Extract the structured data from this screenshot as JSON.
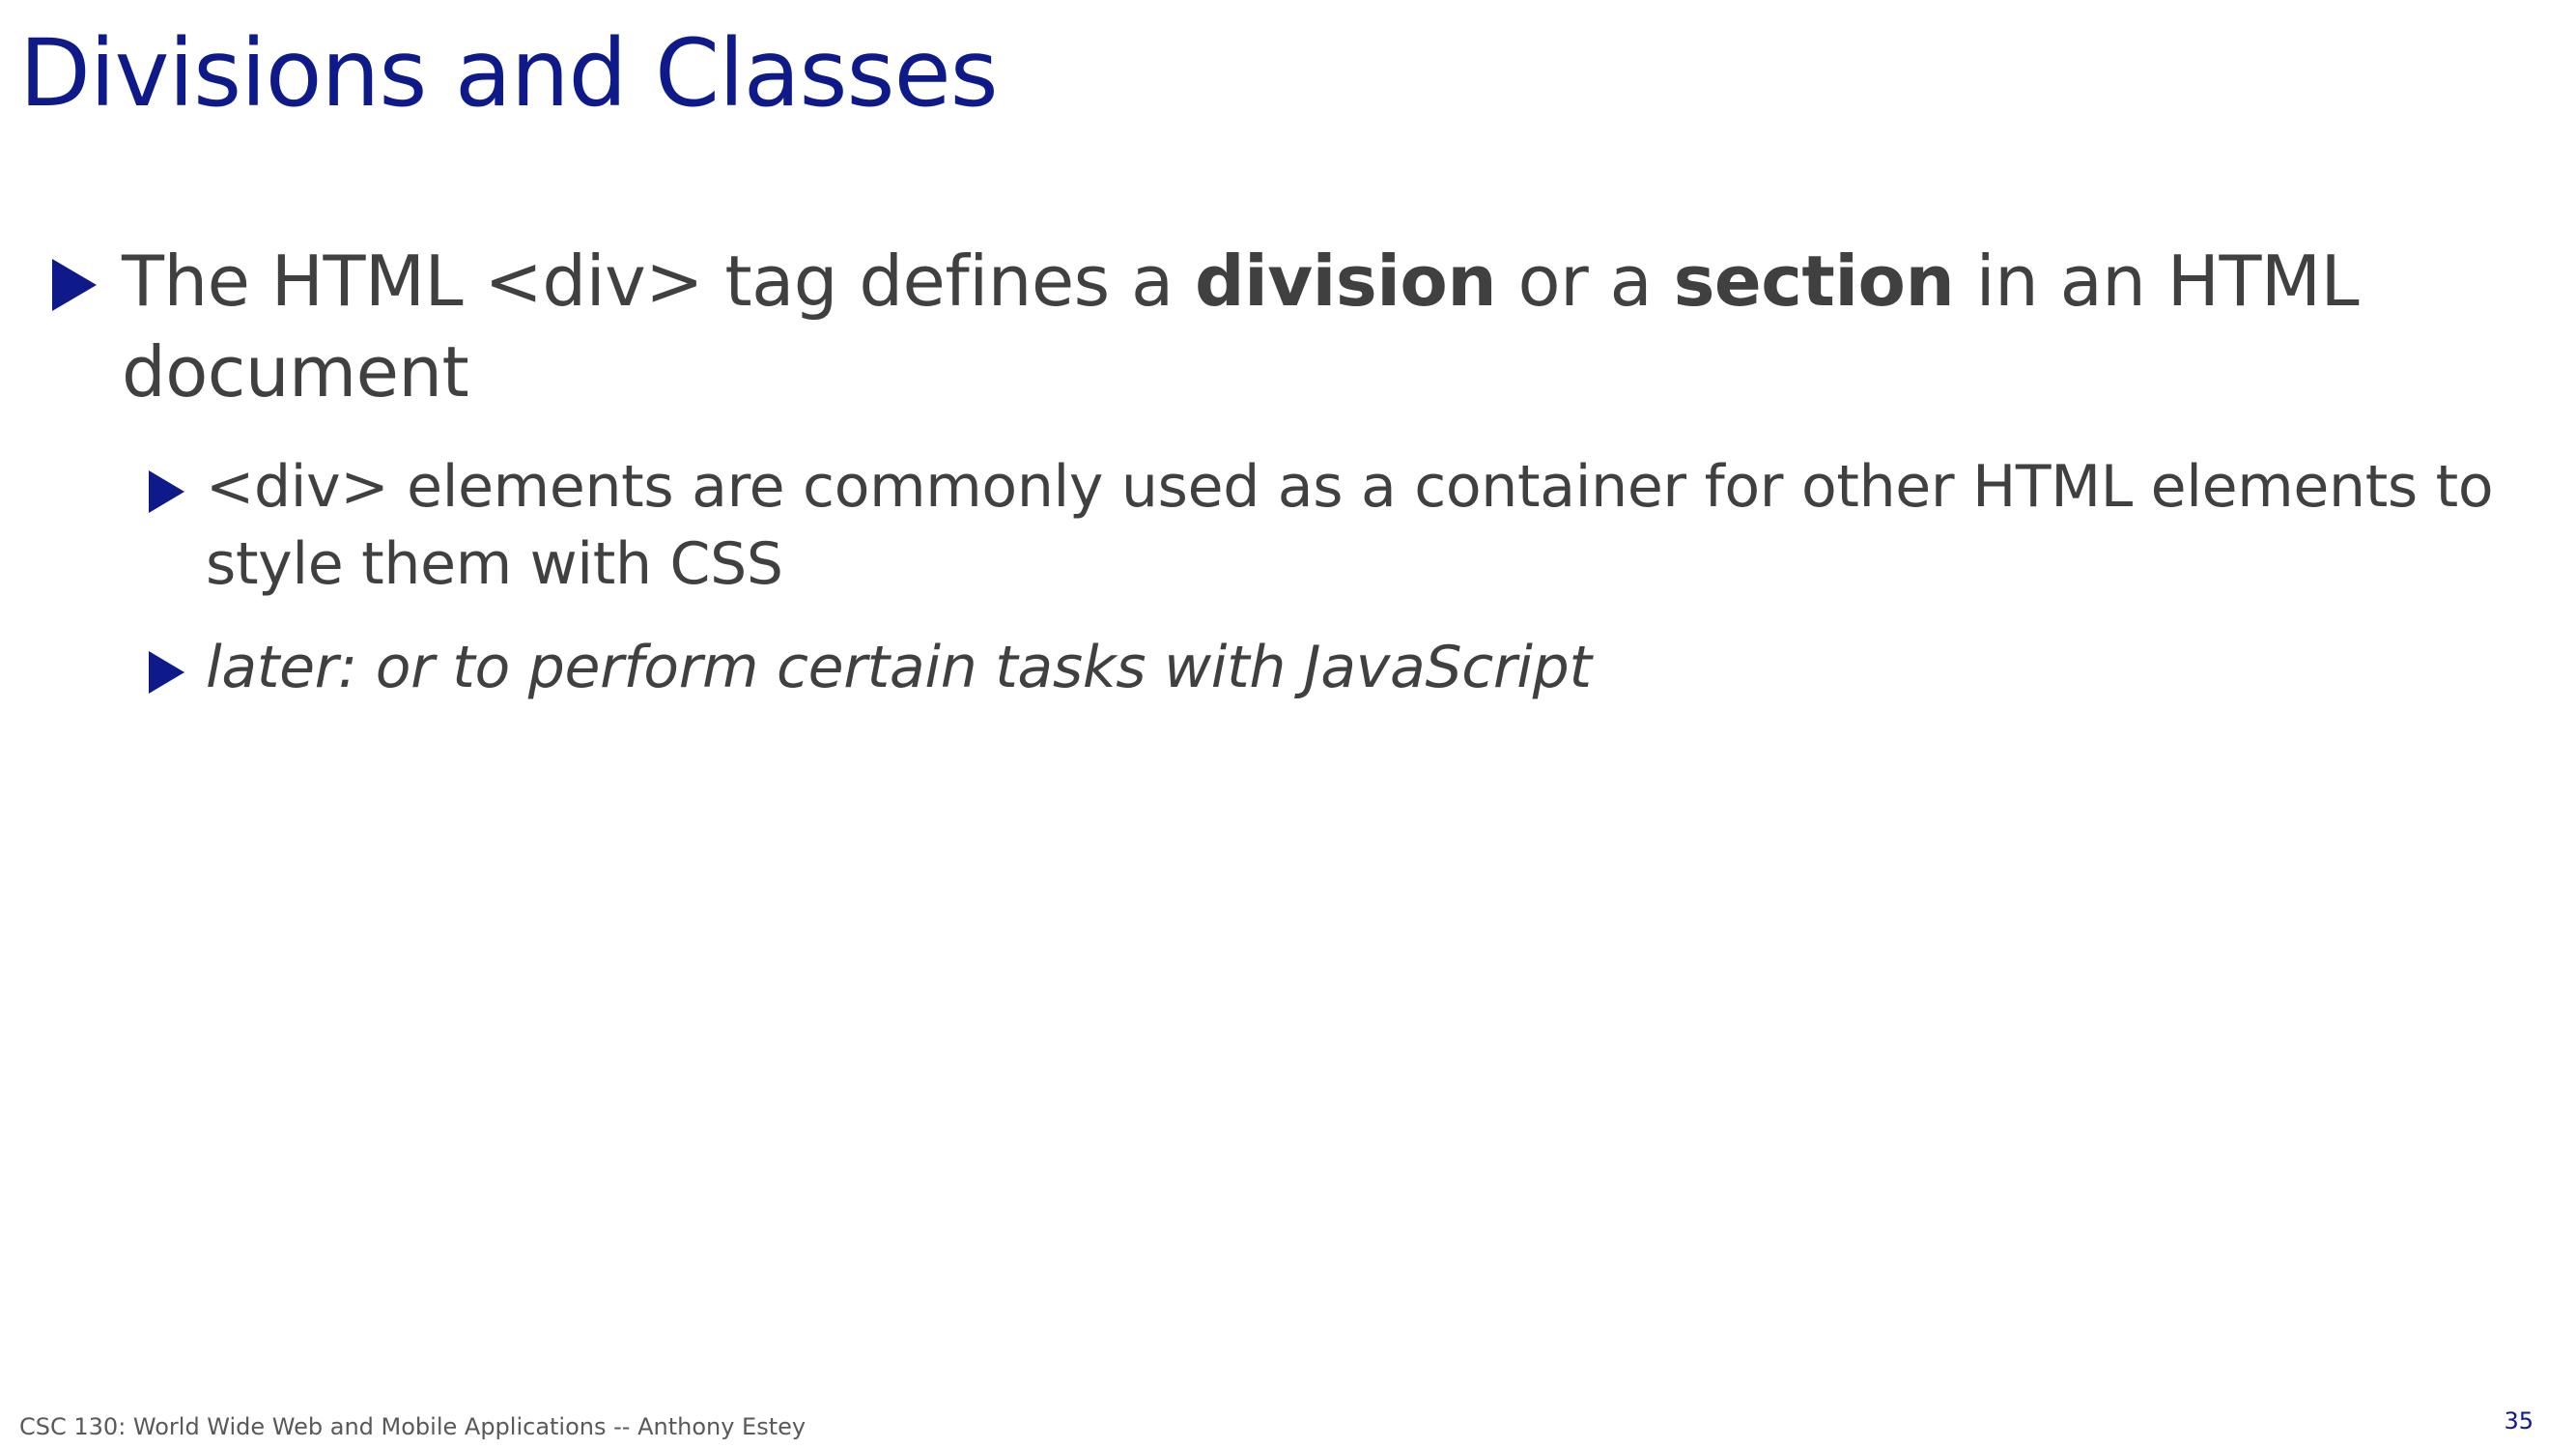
{
  "slide": {
    "title": "Divisions and Classes",
    "bullets": [
      {
        "level": 1,
        "parts": [
          {
            "text": "The HTML <div> tag defines a ",
            "style": "normal"
          },
          {
            "text": "division",
            "style": "bold"
          },
          {
            "text": " or a ",
            "style": "normal"
          },
          {
            "text": "section",
            "style": "bold"
          },
          {
            "text": " in an HTML document",
            "style": "normal"
          }
        ]
      },
      {
        "level": 2,
        "text": "<div> elements are commonly used as a container for other HTML elements to style them with CSS"
      },
      {
        "level": 2,
        "text": "later: or to perform certain tasks with JavaScript",
        "style": "italic"
      }
    ],
    "footer": "CSC 130: World Wide Web and Mobile Applications -- Anthony Estey",
    "page_number": "35"
  },
  "colors": {
    "title": "#0f1a8a",
    "bullet_marker": "#0f1a8a",
    "body_text": "#404040",
    "footer_text": "#595959",
    "page_number": "#0f1a8a"
  },
  "icons": {
    "bullet": "triangle-right-icon"
  }
}
